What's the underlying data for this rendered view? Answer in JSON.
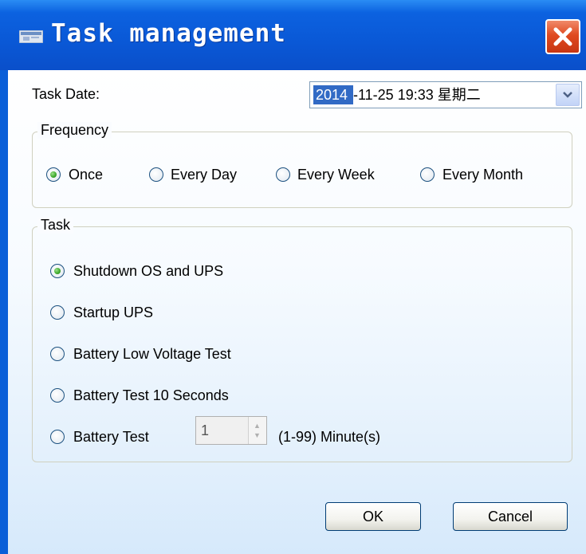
{
  "window": {
    "title": "Task management",
    "app_icon": "app-window-icon",
    "close_icon": "close-icon"
  },
  "task_date": {
    "label": "Task Date:",
    "selected_part": "2014",
    "rest": "-11-25 19:33 星期二",
    "dropdown_icon": "chevron-down-icon"
  },
  "frequency": {
    "legend": "Frequency",
    "options": [
      {
        "label": "Once",
        "checked": true
      },
      {
        "label": "Every Day",
        "checked": false
      },
      {
        "label": "Every Week",
        "checked": false
      },
      {
        "label": "Every Month",
        "checked": false
      }
    ]
  },
  "task": {
    "legend": "Task",
    "options": [
      {
        "label": "Shutdown OS and UPS",
        "checked": true
      },
      {
        "label": "Startup UPS",
        "checked": false
      },
      {
        "label": "Battery Low Voltage Test",
        "checked": false
      },
      {
        "label": "Battery Test 10 Seconds",
        "checked": false
      },
      {
        "label": "Battery Test",
        "checked": false
      }
    ],
    "minutes_value": "1",
    "minutes_hint": "(1-99) Minute(s)"
  },
  "buttons": {
    "ok": "OK",
    "cancel": "Cancel"
  },
  "colors": {
    "titlebar": "#0a58d6",
    "close": "#e04a20",
    "selection": "#316ac5"
  }
}
